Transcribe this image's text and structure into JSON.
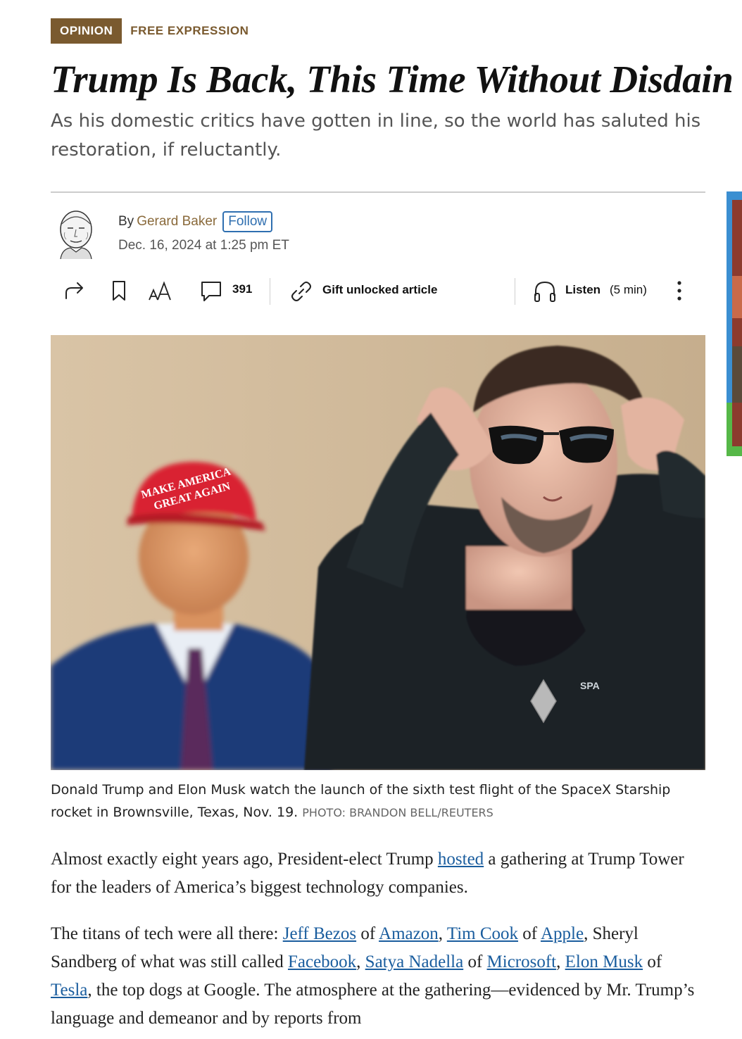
{
  "flags": {
    "opinion": "OPINION",
    "section": "FREE EXPRESSION"
  },
  "headline": "Trump Is Back, This Time Without Disdain",
  "dek": "As his domestic critics have gotten in line, so the world has saluted his restoration, if reluctantly.",
  "byline": {
    "by": "By",
    "author": "Gerard Baker",
    "follow_label": "Follow",
    "timestamp": "Dec. 16, 2024 at 1:25 pm ET"
  },
  "toolbar": {
    "share_icon": "share-icon",
    "bookmark_icon": "bookmark-icon",
    "text_size_icon": "text-size-icon",
    "comments_icon": "comment-icon",
    "comment_count": "391",
    "gift_icon": "link-icon",
    "gift_label": "Gift unlocked article",
    "listen_icon": "headphones-icon",
    "listen_label": "Listen",
    "listen_duration": "(5 min)",
    "more_icon": "more-vertical-icon"
  },
  "photo": {
    "hat_text_1": "MAKE AMERICA",
    "hat_text_2": "GREAT AGAIN",
    "shirt_text": "SPA"
  },
  "caption": {
    "text": "Donald Trump and Elon Musk watch the launch of the sixth test flight of the SpaceX Starship rocket in Brownsville, Texas, Nov. 19.",
    "credit": "PHOTO: BRANDON BELL/REUTERS"
  },
  "body": {
    "p1": {
      "a": "Almost exactly eight years ago, President-elect Trump ",
      "link_hosted": "hosted",
      "b": " a gathering at Trump Tower for the leaders of America’s biggest technology companies."
    },
    "p2": {
      "a": "The titans of tech were all there: ",
      "link_bezos": "Jeff Bezos",
      "of1": " of ",
      "link_amazon": "Amazon",
      "c1": ", ",
      "link_cook": "Tim Cook",
      "of2": " of ",
      "link_apple": "Apple",
      "c2": ", Sheryl Sandberg of what was still called ",
      "link_facebook": "Facebook",
      "c3": ", ",
      "link_nadella": "Satya Nadella",
      "of3": " of ",
      "link_microsoft": "Microsoft",
      "c4": ", ",
      "link_musk": "Elon Musk",
      "of4": " of ",
      "link_tesla": "Tesla",
      "c5": ", the top dogs at Google. The atmosphere at the gathering—evidenced by Mr. Trump’s language and demeanor and by reports from"
    }
  },
  "colors": {
    "opinion_brown": "#7a5a2f",
    "link_blue": "#1a5d9e",
    "follow_blue": "#2f6fb0"
  }
}
